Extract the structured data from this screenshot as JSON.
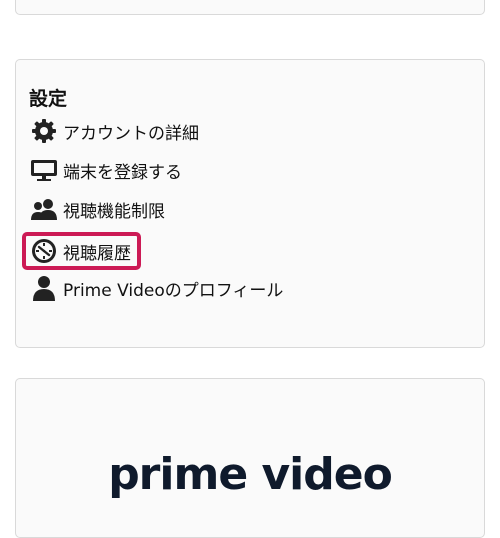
{
  "settings": {
    "title": "設定",
    "items": [
      {
        "label": "アカウントの詳細",
        "icon": "gear-icon"
      },
      {
        "label": "端末を登録する",
        "icon": "monitor-icon"
      },
      {
        "label": "視聴機能制限",
        "icon": "users-icon"
      },
      {
        "label": "視聴履歴",
        "icon": "clock-icon"
      },
      {
        "label": "Prime Videoのプロフィール",
        "icon": "user-icon"
      }
    ]
  },
  "logo": {
    "text": "prime video"
  },
  "colors": {
    "highlight": "#cc1a55",
    "card_border": "#d9d9d9",
    "card_background": "#fafafa",
    "logo_text": "#0f1a2c"
  }
}
